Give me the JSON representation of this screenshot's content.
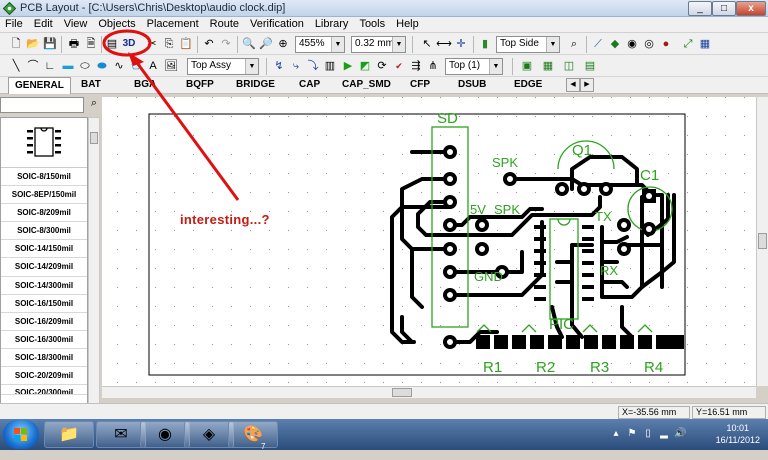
{
  "window": {
    "title": "PCB Layout - [C:\\Users\\Chris\\Desktop\\audio clock.dip]",
    "min_label": "_",
    "max_label": "□",
    "close_label": "x"
  },
  "menu": [
    "File",
    "Edit",
    "View",
    "Objects",
    "Placement",
    "Route",
    "Verification",
    "Library",
    "Tools",
    "Help"
  ],
  "toolbar1": {
    "zoom": "455%",
    "track_width": "0.32 mm",
    "side": "Top Side",
    "btn_3d": "3D"
  },
  "toolbar2": {
    "layer_assy": "Top Assy",
    "layer_top": "Top (1)"
  },
  "tabs": [
    "GENERAL",
    "BAT",
    "BGA",
    "BQFP",
    "BRIDGE",
    "CAP",
    "CAP_SMD",
    "CFP",
    "DSUB",
    "EDGE"
  ],
  "library": {
    "items": [
      "SOIC-8/150mil",
      "SOIC-8EP/150mil",
      "SOIC-8/209mil",
      "SOIC-8/300mil",
      "SOIC-14/150mil",
      "SOIC-14/209mil",
      "SOIC-14/300mil",
      "SOIC-16/150mil",
      "SOIC-16/209mil",
      "SOIC-16/300mil",
      "SOIC-18/300mil",
      "SOIC-20/209mil"
    ],
    "partial_item": "SOIC-20/300mil"
  },
  "pcb": {
    "labels": {
      "sd": "SD",
      "spk": "SPK",
      "q1": "Q1",
      "c1": "C1",
      "v5": "5V",
      "spk2": "SPK",
      "tx": "TX",
      "rx": "RX",
      "gnd": "GND",
      "pic": "PIC",
      "r1": "R1",
      "r2": "R2",
      "r3": "R3",
      "r4": "R4"
    }
  },
  "status": {
    "x": "X=-35.56 mm",
    "y": "Y=16.51 mm"
  },
  "taskbar": {
    "time": "10:01",
    "date": "16/11/2012",
    "badge": "7"
  },
  "annotation": {
    "text": "interesting...?",
    "color": "#c51b12"
  },
  "colors": {
    "silkscreen": "#2ea31f",
    "copper": "#000000",
    "annotation": "#e01010"
  }
}
